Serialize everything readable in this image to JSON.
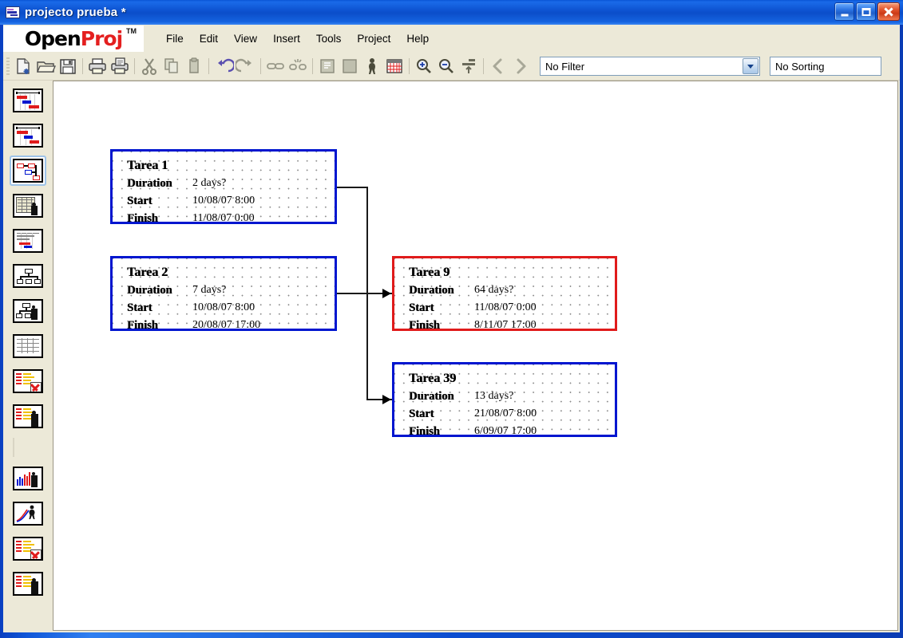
{
  "window": {
    "title": "projecto prueba *",
    "icon": "project-file-icon",
    "buttons": {
      "minimize": "Minimize",
      "maximize": "Maximize",
      "close": "Close"
    }
  },
  "brand": {
    "open": "Open",
    "proj": "Proj",
    "tm": "TM"
  },
  "menu": {
    "items": [
      {
        "label": "File"
      },
      {
        "label": "Edit"
      },
      {
        "label": "View"
      },
      {
        "label": "Insert"
      },
      {
        "label": "Tools"
      },
      {
        "label": "Project"
      },
      {
        "label": "Help"
      }
    ]
  },
  "toolbar": {
    "icons": [
      {
        "name": "new-project-icon",
        "title": "New"
      },
      {
        "name": "open-project-icon",
        "title": "Open"
      },
      {
        "name": "save-icon",
        "title": "Save"
      },
      {
        "name": "print-icon",
        "title": "Print"
      },
      {
        "name": "print-preview-icon",
        "title": "Print Preview"
      },
      {
        "name": "cut-icon",
        "title": "Cut"
      },
      {
        "name": "copy-icon",
        "title": "Copy"
      },
      {
        "name": "paste-icon",
        "title": "Paste"
      },
      {
        "name": "undo-icon",
        "title": "Undo"
      },
      {
        "name": "redo-icon",
        "title": "Redo"
      },
      {
        "name": "link-tasks-icon",
        "title": "Link Tasks"
      },
      {
        "name": "unlink-tasks-icon",
        "title": "Unlink Tasks"
      },
      {
        "name": "indent-icon",
        "title": "Indent"
      },
      {
        "name": "outdent-icon",
        "title": "Outdent"
      },
      {
        "name": "assign-resources-icon",
        "title": "Assign Resources"
      },
      {
        "name": "calendar-icon",
        "title": "Calendar"
      },
      {
        "name": "zoom-in-icon",
        "title": "Zoom In"
      },
      {
        "name": "zoom-out-icon",
        "title": "Zoom Out"
      },
      {
        "name": "level-resources-icon",
        "title": "Level Resources"
      },
      {
        "name": "back-icon",
        "title": "Back"
      },
      {
        "name": "forward-icon",
        "title": "Forward"
      }
    ],
    "filter": {
      "value": "No Filter"
    },
    "sorting": {
      "value": "No Sorting"
    }
  },
  "viewbar": {
    "items": [
      {
        "name": "gantt-view",
        "selected": false
      },
      {
        "name": "tracking-gantt-view",
        "selected": false
      },
      {
        "name": "network-diagram-view",
        "selected": true
      },
      {
        "name": "task-usage-view",
        "selected": false
      },
      {
        "name": "resource-gantt-view",
        "selected": false
      },
      {
        "name": "wbs-view",
        "selected": false
      },
      {
        "name": "rbs-view",
        "selected": false
      },
      {
        "name": "spreadsheet-view",
        "selected": false
      },
      {
        "name": "resource-usage-detail-view",
        "selected": false
      },
      {
        "name": "resource-usage-view",
        "selected": false
      },
      {
        "name": "histogram-view",
        "selected": false
      },
      {
        "name": "chart-view",
        "selected": false
      },
      {
        "name": "resource-sheet-view",
        "selected": false
      },
      {
        "name": "resource-list-view",
        "selected": false
      }
    ]
  },
  "diagram": {
    "labels": {
      "duration": "Duration",
      "start": "Start",
      "finish": "Finish"
    },
    "nodes": [
      {
        "id": "tarea-1",
        "name": "Tarea 1",
        "duration": "2 days?",
        "start": "10/08/07 8:00",
        "finish": "11/08/07 0:00",
        "critical": false,
        "border_color": "#0016cf"
      },
      {
        "id": "tarea-2",
        "name": "Tarea 2",
        "duration": "7 days?",
        "start": "10/08/07 8:00",
        "finish": "20/08/07 17:00",
        "critical": false,
        "border_color": "#0016cf"
      },
      {
        "id": "tarea-9",
        "name": "Tarea 9",
        "duration": "64 days?",
        "start": "11/08/07 0:00",
        "finish": "8/11/07 17:00",
        "critical": true,
        "border_color": "#e01b1b"
      },
      {
        "id": "tarea-39",
        "name": "Tarea 39",
        "duration": "13 days?",
        "start": "21/08/07 8:00",
        "finish": "6/09/07 17:00",
        "critical": false,
        "border_color": "#0016cf"
      }
    ],
    "links": [
      {
        "from": "tarea-1",
        "to": "tarea-39"
      },
      {
        "from": "tarea-2",
        "to": "tarea-9"
      }
    ]
  }
}
